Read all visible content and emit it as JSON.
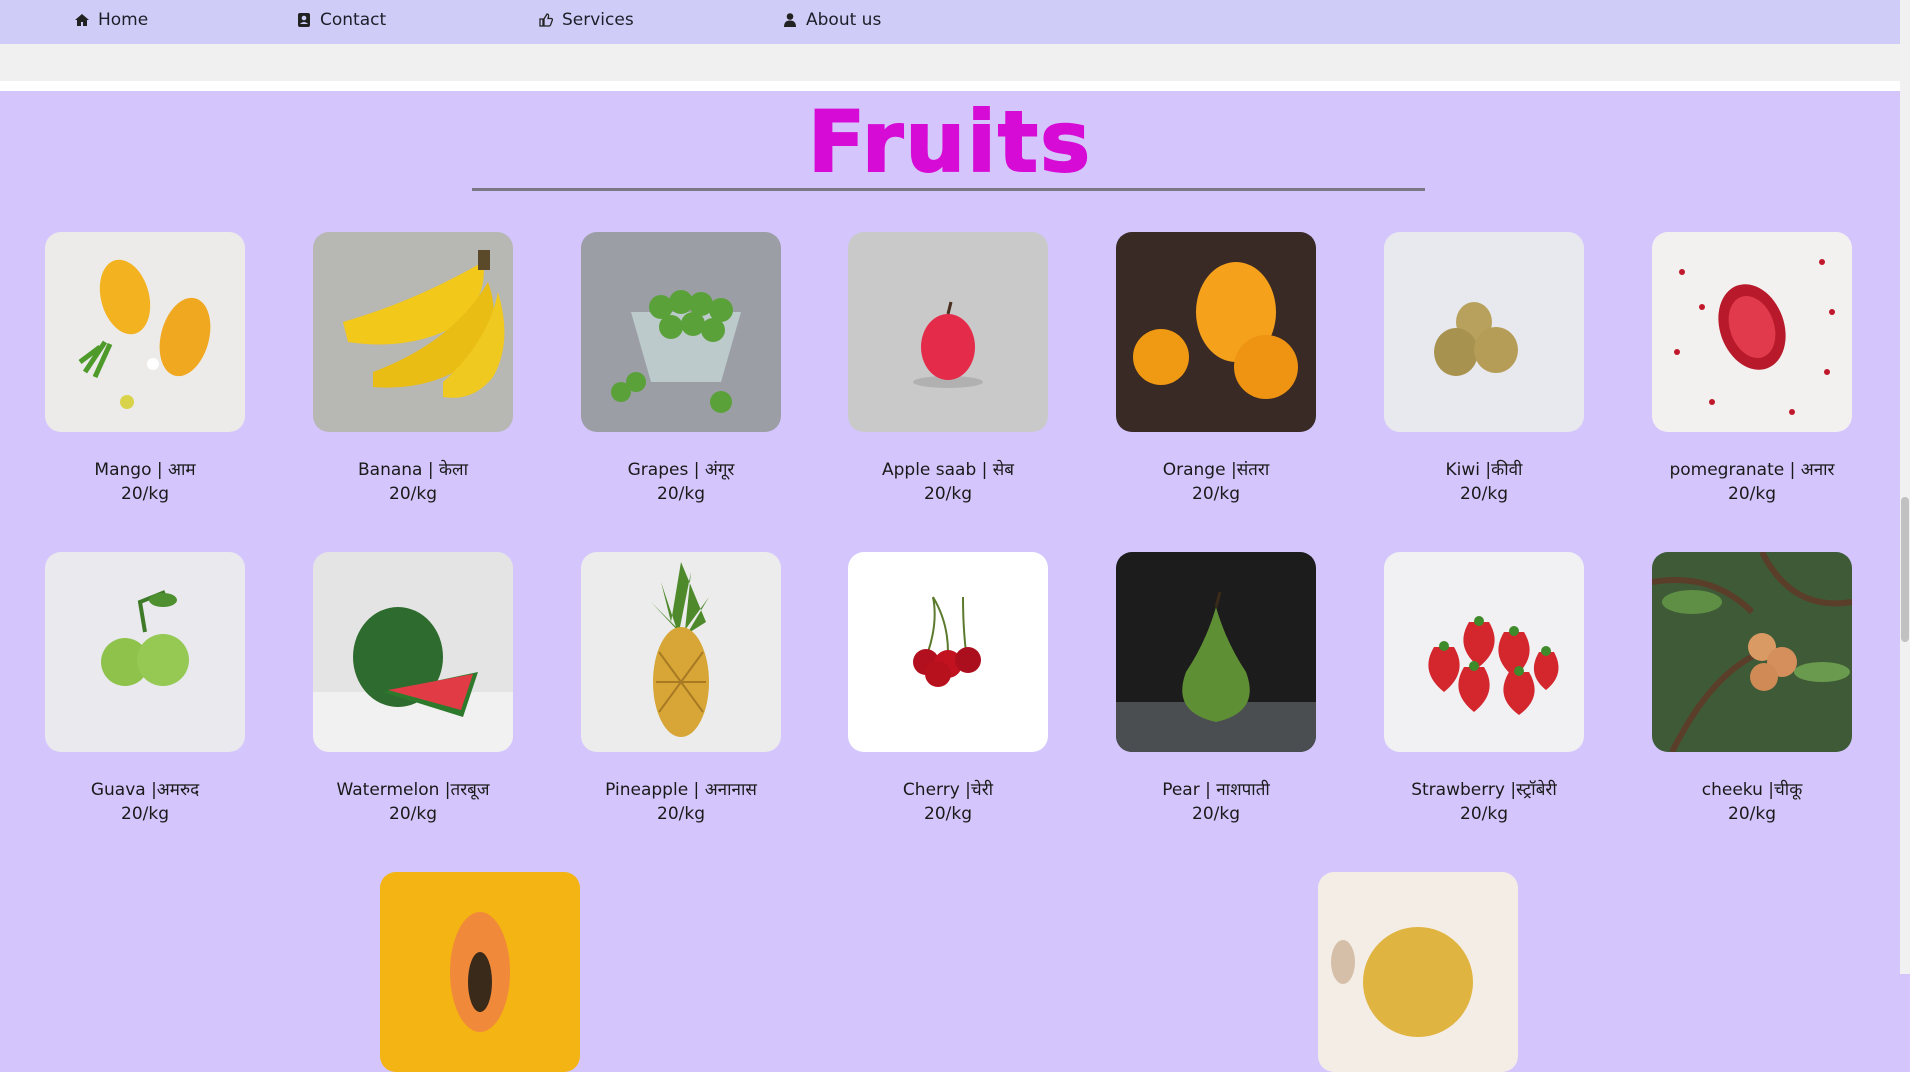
{
  "nav": {
    "home": "Home",
    "contact": "Contact",
    "services": "Services",
    "about": "About us"
  },
  "section_title": "Fruits",
  "fruits": [
    {
      "name": "Mango | आम",
      "price": "20/kg",
      "icon": "mango-image"
    },
    {
      "name": "Banana | केला",
      "price": "20/kg",
      "icon": "banana-image"
    },
    {
      "name": "Grapes | अंगूर",
      "price": "20/kg",
      "icon": "grapes-image"
    },
    {
      "name": "Apple saab | सेब",
      "price": "20/kg",
      "icon": "apple-image"
    },
    {
      "name": "Orange |संतरा",
      "price": "20/kg",
      "icon": "orange-image"
    },
    {
      "name": "Kiwi |कीवी",
      "price": "20/kg",
      "icon": "kiwi-image"
    },
    {
      "name": "pomegranate | अनार",
      "price": "20/kg",
      "icon": "pomegranate-image"
    },
    {
      "name": "Guava |अमरुद",
      "price": "20/kg",
      "icon": "guava-image"
    },
    {
      "name": "Watermelon |तरबूज",
      "price": "20/kg",
      "icon": "watermelon-image"
    },
    {
      "name": "Pineapple | अनानास",
      "price": "20/kg",
      "icon": "pineapple-image"
    },
    {
      "name": "Cherry |चेरी",
      "price": "20/kg",
      "icon": "cherry-image"
    },
    {
      "name": "Pear | नाशपाती",
      "price": "20/kg",
      "icon": "pear-image"
    },
    {
      "name": "Strawberry |स्ट्रॉबेरी",
      "price": "20/kg",
      "icon": "strawberry-image"
    },
    {
      "name": "cheeku |चीकू",
      "price": "20/kg",
      "icon": "cheeku-image"
    }
  ],
  "partial_images": [
    "papaya-image",
    "muskmelon-image"
  ],
  "colors": {
    "background": "#d4c6fc",
    "navbar": "#cfcdf7",
    "title": "#d70bd6"
  }
}
